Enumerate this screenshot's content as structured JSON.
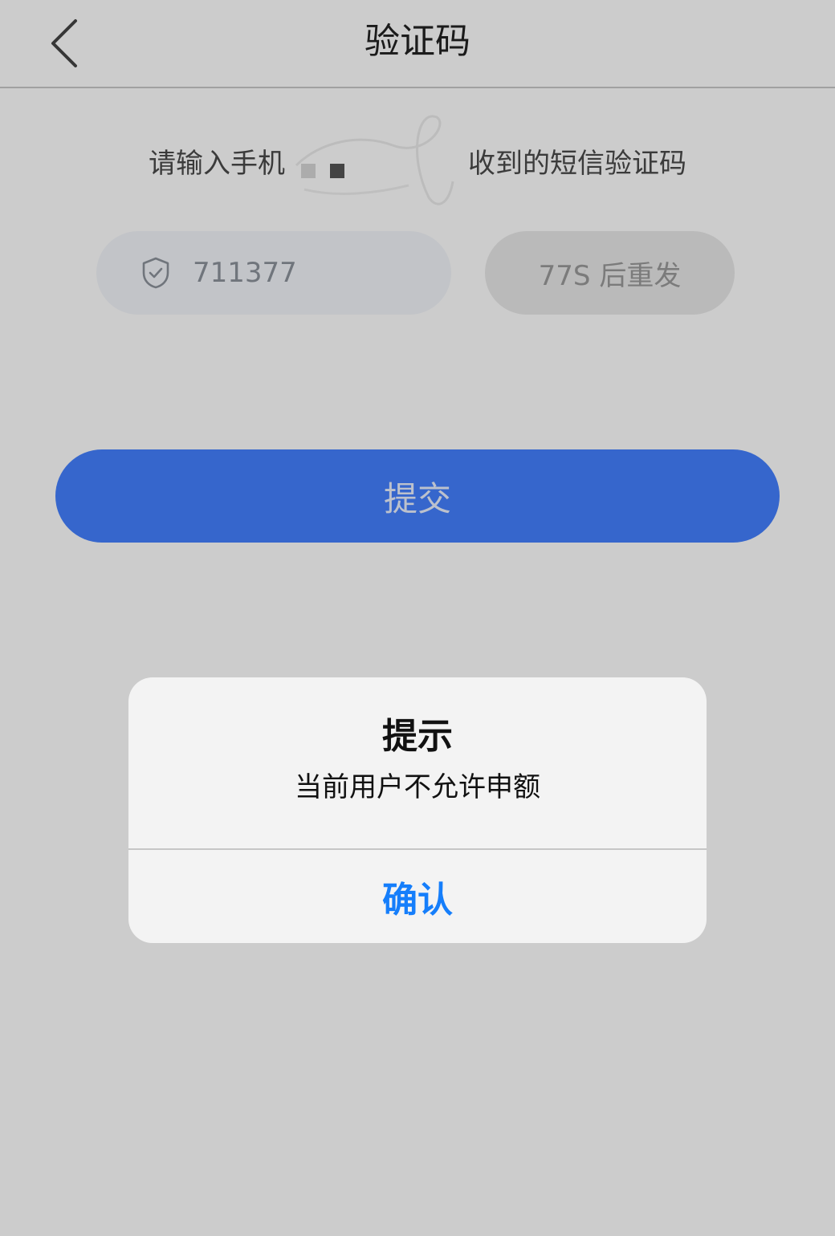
{
  "nav": {
    "title": "验证码",
    "back_icon": "chevron-left-icon"
  },
  "hint": {
    "prefix": "请输入手机",
    "suffix": "收到的短信验证码"
  },
  "code_input": {
    "value": "711377",
    "icon": "shield-check-icon"
  },
  "resend": {
    "label": "77S 后重发"
  },
  "submit": {
    "label": "提交"
  },
  "alert": {
    "title": "提示",
    "message": "当前用户不允许申额",
    "confirm_label": "确认"
  },
  "colors": {
    "primary": "#4480ff",
    "alert_action": "#157efb",
    "page_bg": "#ffffff",
    "input_bg": "#f3f6fb",
    "resend_bg": "#e9e9e9"
  }
}
